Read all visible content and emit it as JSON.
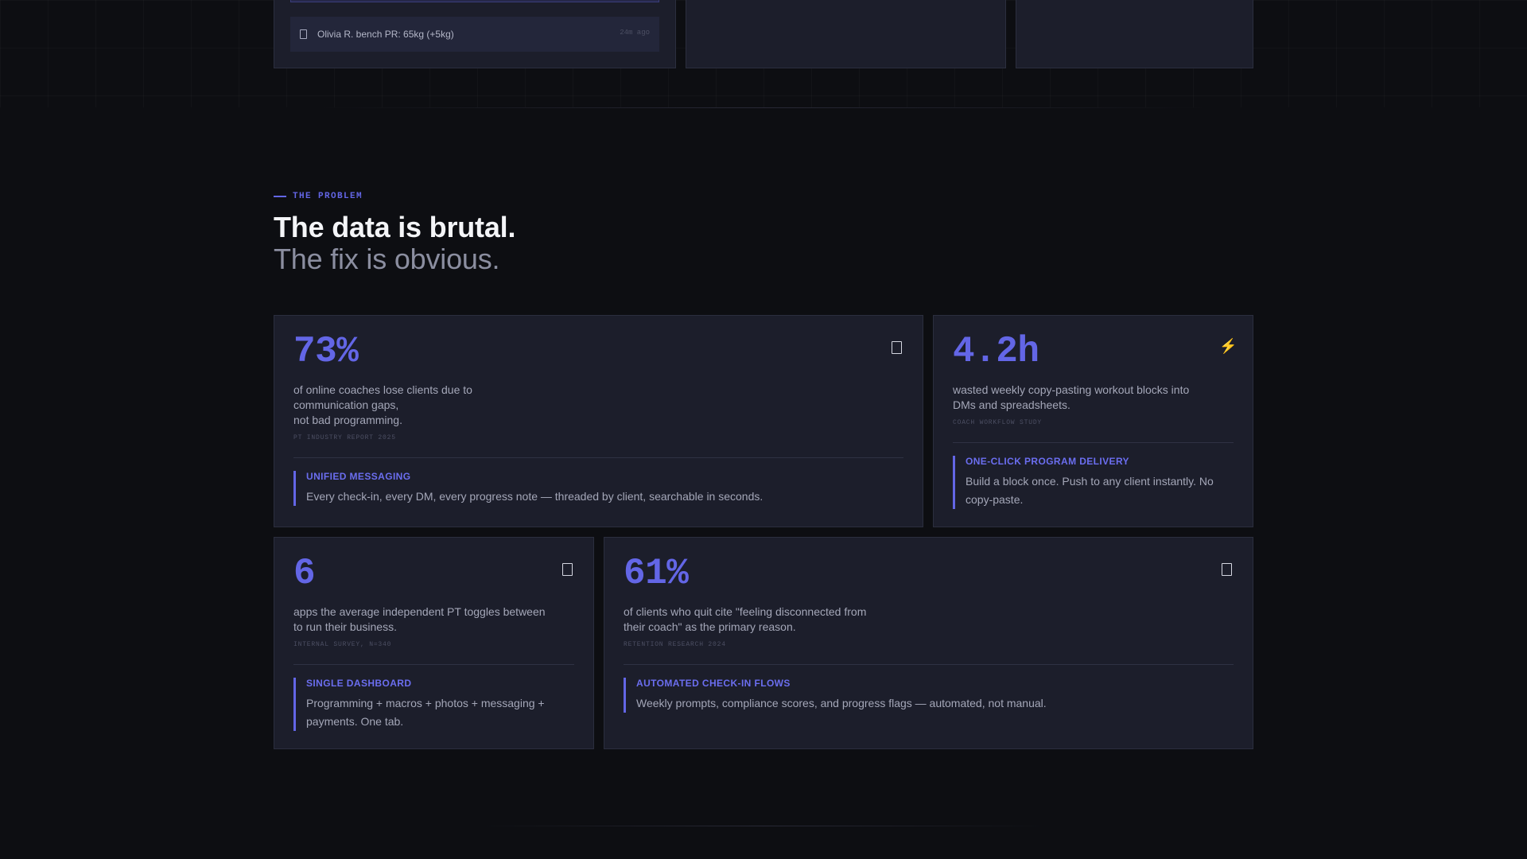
{
  "top": {
    "feed_item": {
      "text": "Olivia R. bench PR: 65kg (+5kg)",
      "time": "24m ago"
    }
  },
  "problem": {
    "eyebrow": "THE PROBLEM",
    "heading": "The data is brutal.",
    "subheading": "The fix is obvious."
  },
  "cards": [
    {
      "stat": "73%",
      "description": "of online coaches lose clients due to\ncommunication gaps,\nnot bad programming.",
      "source": "PT INDUSTRY REPORT 2025",
      "feature_title": "UNIFIED MESSAGING",
      "feature_desc": "Every check-in, every DM, every progress note — threaded by client, searchable in seconds.",
      "icon": "message-icon"
    },
    {
      "stat": "4.2h",
      "description": "wasted weekly copy-pasting workout blocks into\nDMs and spreadsheets.",
      "source": "COACH WORKFLOW STUDY",
      "feature_title": "ONE-CLICK PROGRAM DELIVERY",
      "feature_desc": "Build a block once. Push to any client instantly. No copy-paste.",
      "icon": "lightning-icon",
      "icon_glyph": "⚡"
    },
    {
      "stat": "6",
      "description": "apps the average independent PT toggles between\nto run their business.",
      "source": "INTERNAL SURVEY, N=340",
      "feature_title": "SINGLE DASHBOARD",
      "feature_desc": "Programming + macros + photos + messaging + payments. One tab.",
      "icon": "dashboard-icon"
    },
    {
      "stat": "61%",
      "description": "of clients who quit cite \"feeling disconnected from\ntheir coach\" as the primary reason.",
      "source": "RETENTION RESEARCH 2024",
      "feature_title": "AUTOMATED CHECK-IN FLOWS",
      "feature_desc": "Weekly prompts, compliance scores, and progress flags — automated, not manual.",
      "icon": "checkin-icon"
    }
  ],
  "colors": {
    "accent": "#6366e6",
    "background": "#0d0e12",
    "card": "#1c1e2b"
  }
}
